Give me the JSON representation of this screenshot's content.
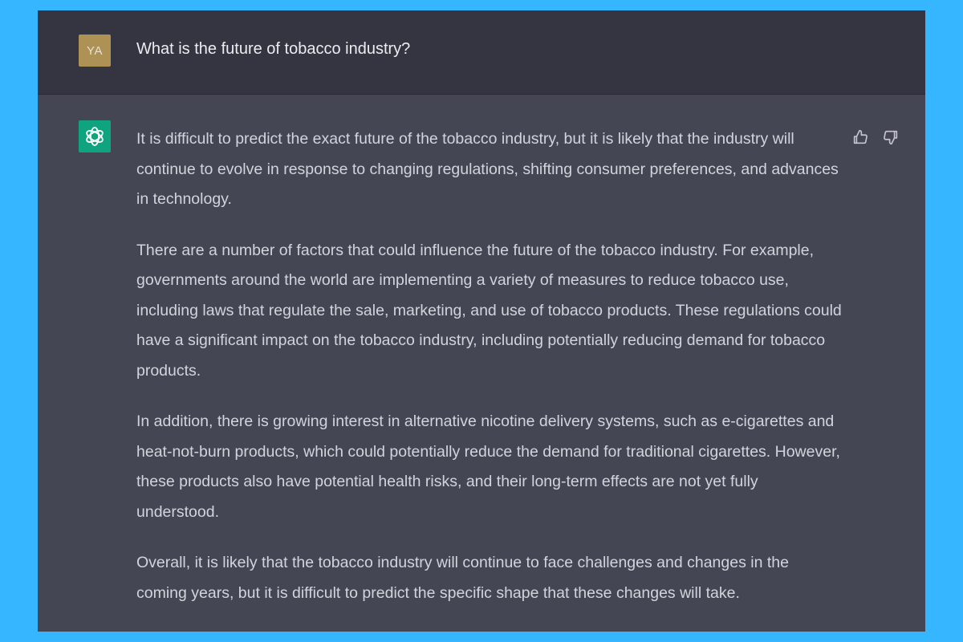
{
  "user": {
    "avatar_initials": "YA",
    "avatar_color": "#ae9255",
    "message": "What is the future of tobacco industry?"
  },
  "assistant": {
    "avatar_icon": "openai-logo-icon",
    "avatar_color": "#10a37f",
    "paragraphs": [
      "It is difficult to predict the exact future of the tobacco industry, but it is likely that the industry will continue to evolve in response to changing regulations, shifting consumer preferences, and advances in technology.",
      "There are a number of factors that could influence the future of the tobacco industry. For example, governments around the world are implementing a variety of measures to reduce tobacco use, including laws that regulate the sale, marketing, and use of tobacco products. These regulations could have a significant impact on the tobacco industry, including potentially reducing demand for tobacco products.",
      "In addition, there is growing interest in alternative nicotine delivery systems, such as e-cigarettes and heat-not-burn products, which could potentially reduce the demand for traditional cigarettes. However, these products also have potential health risks, and their long-term effects are not yet fully understood.",
      "Overall, it is likely that the tobacco industry will continue to face challenges and changes in the coming years, but it is difficult to predict the specific shape that these changes will take."
    ],
    "feedback_icons": [
      "thumbs-up-icon",
      "thumbs-down-icon"
    ]
  },
  "colors": {
    "page_background": "#35b6ff",
    "user_row_background": "#343541",
    "assistant_row_background": "#444654",
    "text": "#d1d5db"
  }
}
